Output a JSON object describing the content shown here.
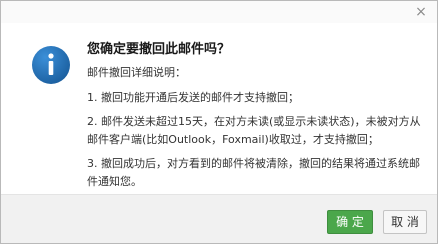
{
  "dialog": {
    "close_glyph": "×",
    "icon": "info-icon",
    "title": "您确定要撤回此邮件吗？",
    "subtitle": "邮件撤回详细说明：",
    "items": [
      "1. 撤回功能开通后发送的邮件才支持撤回；",
      "2. 邮件发送未超过15天，在对方未读(或显示未读状态)，未被对方从邮件客户端(比如Outlook，Foxmail)收取过，才支持撤回；",
      "3. 撤回成功后，对方看到的邮件将被清除，撤回的结果将通过系统邮件通知您。"
    ]
  },
  "buttons": {
    "ok": "确 定",
    "cancel": "取 消"
  },
  "colors": {
    "accent": "#4ba74b",
    "info_icon": "#1f6fb6"
  }
}
